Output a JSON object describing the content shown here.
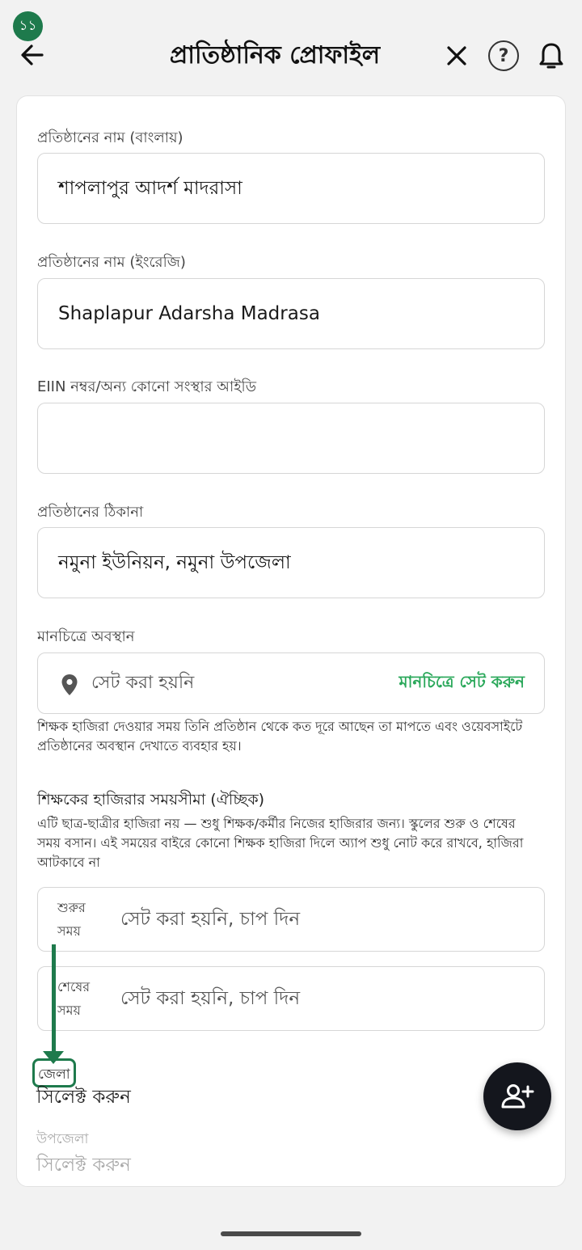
{
  "header": {
    "step_badge": "১১",
    "title": "প্রাতিষ্ঠানিক প্রোফাইল",
    "help_symbol": "?"
  },
  "form": {
    "name_bn": {
      "label": "প্রতিষ্ঠানের নাম (বাংলায়)",
      "value": "শাপলাপুর আদর্শ মাদরাসা"
    },
    "name_en": {
      "label": "প্রতিষ্ঠানের নাম (ইংরেজি)",
      "value": "Shaplapur Adarsha Madrasa"
    },
    "eiin": {
      "label": "EIIN নম্বর/অন্য কোনো সংস্থার আইডি",
      "value": ""
    },
    "address": {
      "label": "প্রতিষ্ঠানের ঠিকানা",
      "value": "নমুনা ইউনিয়ন, নমুনা উপজেলা"
    },
    "map": {
      "label": "মানচিত্রে অবস্থান",
      "status": "সেট করা হয়নি",
      "action": "মানচিত্রে সেট করুন",
      "help": "শিক্ষক হাজিরা দেওয়ার সময় তিনি প্রতিষ্ঠান থেকে কত দূরে আছেন তা মাপতে এবং ওয়েবসাইটে প্রতিষ্ঠানের অবস্থান দেখাতে ব্যবহার হয়।"
    },
    "attendance": {
      "title": "শিক্ষকের হাজিরার সময়সীমা (ঐচ্ছিক)",
      "help": "এটি ছাত্র-ছাত্রীর হাজিরা নয় — শুধু শিক্ষক/কর্মীর নিজের হাজিরার জন্য। স্কুলের শুরু ও শেষের সময় বসান। এই সময়ের বাইরে কোনো শিক্ষক হাজিরা দিলে অ্যাপ শুধু নোট করে রাখবে, হাজিরা আটকাবে না",
      "start": {
        "label": "শুরুর সময়",
        "value": "সেট করা হয়নি, চাপ দিন"
      },
      "end": {
        "label": "শেষের সময়",
        "value": "সেট করা হয়নি, চাপ দিন"
      }
    },
    "district": {
      "label": "জেলা",
      "value": "সিলেক্ট করুন"
    },
    "upazila": {
      "label": "উপজেলা",
      "value": "সিলেক্ট করুন"
    }
  },
  "colors": {
    "accent_green": "#1e7a4c",
    "action_green": "#2aa85a",
    "fab_dark": "#14161d"
  },
  "icons": {
    "back": "arrow-left-icon",
    "close": "close-icon",
    "help": "question-circle-icon",
    "notifications": "bell-icon",
    "map_pin": "location-pin-icon",
    "fab": "add-person-icon"
  }
}
